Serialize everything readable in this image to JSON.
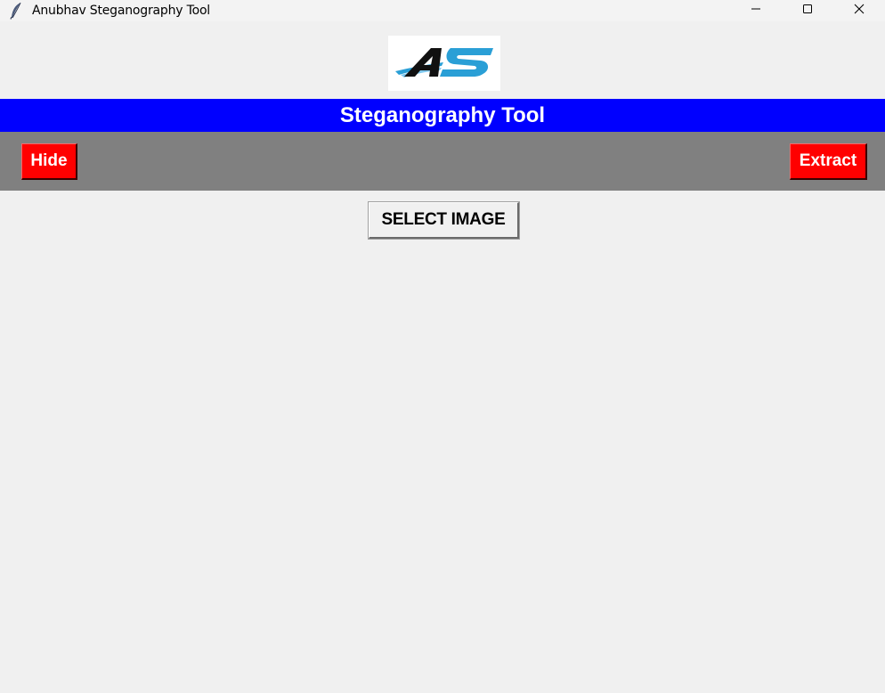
{
  "window": {
    "title": "Anubhav Steganography Tool",
    "icon": "feather-icon",
    "controls": [
      "minimize-icon",
      "maximize-icon",
      "close-icon"
    ]
  },
  "logo": {
    "text": "AS",
    "colors": {
      "a": "#000000",
      "s": "#2a9fd6"
    }
  },
  "header": {
    "title": "Steganography Tool",
    "background": "#0000ff",
    "text_color": "#ffffff"
  },
  "toolbar": {
    "background": "#808080",
    "hide_label": "Hide",
    "extract_label": "Extract",
    "button_color": "#ff0000"
  },
  "main": {
    "select_image_label": "SELECT IMAGE"
  }
}
